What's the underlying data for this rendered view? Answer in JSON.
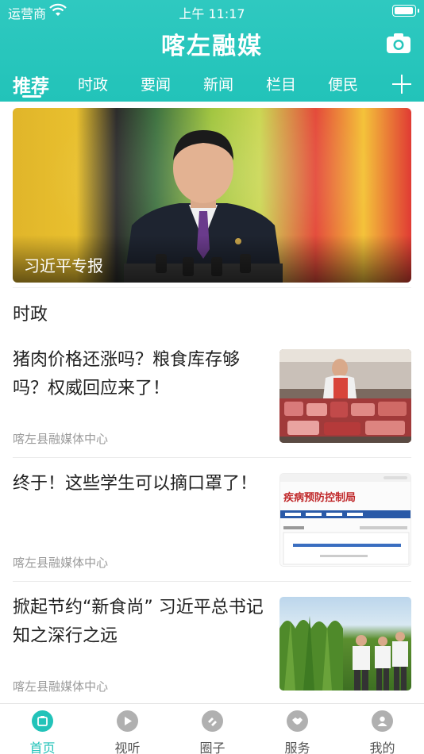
{
  "status_bar": {
    "carrier": "运营商",
    "time": "上午 11:17"
  },
  "header": {
    "app_title": "喀左融媒"
  },
  "tabs": [
    {
      "label": "推荐",
      "active": true
    },
    {
      "label": "时政"
    },
    {
      "label": "要闻"
    },
    {
      "label": "新闻"
    },
    {
      "label": "栏目"
    },
    {
      "label": "便民"
    }
  ],
  "banner": {
    "caption": "习近平专报"
  },
  "section": {
    "title": "时政"
  },
  "news": [
    {
      "title": "猪肉价格还涨吗？粮食库存够吗？权威回应来了！",
      "source": "喀左县融媒体中心",
      "thumb_icon": "market-photo"
    },
    {
      "title": "终于！这些学生可以摘口罩了！",
      "source": "喀左县融媒体中心",
      "thumb_icon": "document-screenshot",
      "thumb_heading": "疾病预防控制局"
    },
    {
      "title": "掀起节约“新食尚” 习近平总书记知之深行之远",
      "source": "喀左县融媒体中心",
      "thumb_icon": "cornfield-photo"
    }
  ],
  "tabbar": [
    {
      "label": "首页",
      "icon": "home-icon",
      "active": true
    },
    {
      "label": "视听",
      "icon": "play-icon"
    },
    {
      "label": "圈子",
      "icon": "circle-icon"
    },
    {
      "label": "服务",
      "icon": "handshake-icon"
    },
    {
      "label": "我的",
      "icon": "user-icon"
    }
  ],
  "colors": {
    "accent": "#22c3b9",
    "inactive": "#b0b0b0"
  }
}
